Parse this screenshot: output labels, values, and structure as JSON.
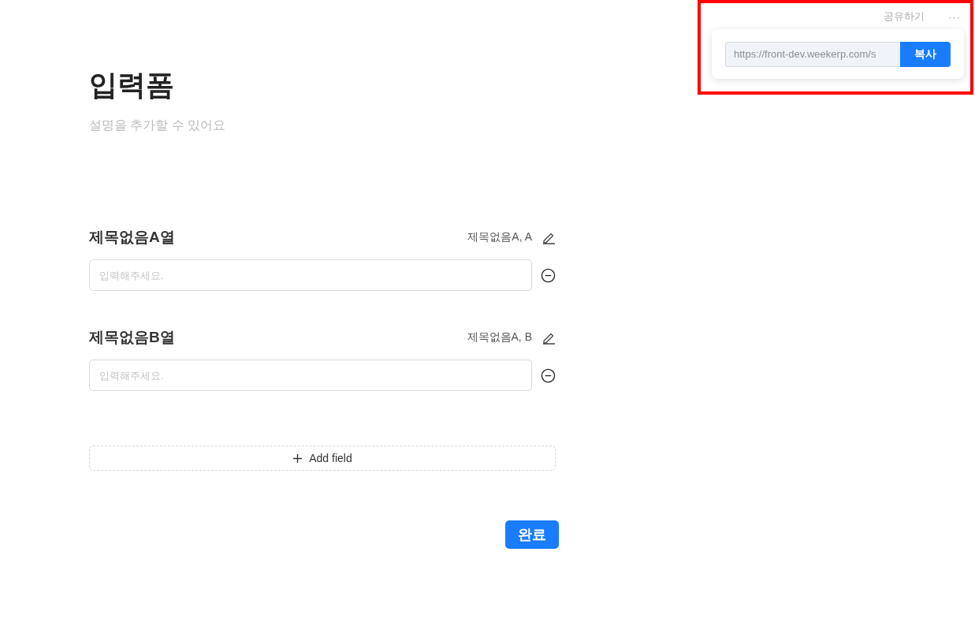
{
  "share": {
    "label": "공유하기",
    "more": "···",
    "url": "https://front-dev.weekerp.com/s",
    "copy_button": "복사"
  },
  "form": {
    "title": "입력폼",
    "description": "설명을 추가할 수 있어요",
    "fields": [
      {
        "label": "제목없음A열",
        "source": "제목없음A, A",
        "placeholder": "입력해주세요."
      },
      {
        "label": "제목없음B열",
        "source": "제목없음A, B",
        "placeholder": "입력해주세요."
      }
    ],
    "add_button": "Add field",
    "submit_button": "완료"
  }
}
